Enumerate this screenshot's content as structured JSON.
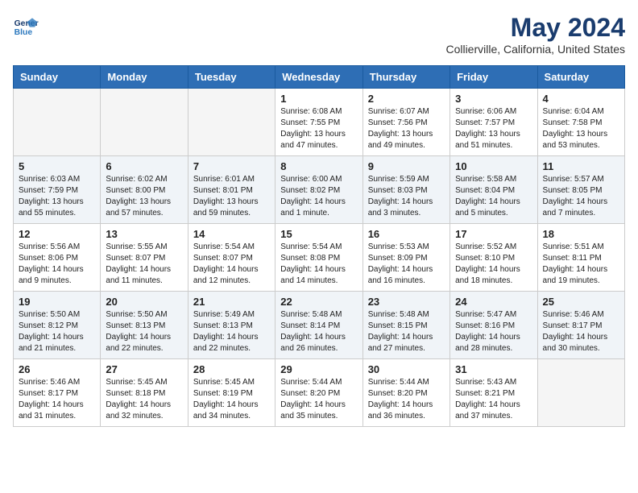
{
  "logo": {
    "line1": "General",
    "line2": "Blue"
  },
  "title": "May 2024",
  "subtitle": "Collierville, California, United States",
  "weekdays": [
    "Sunday",
    "Monday",
    "Tuesday",
    "Wednesday",
    "Thursday",
    "Friday",
    "Saturday"
  ],
  "weeks": [
    [
      {
        "day": "",
        "empty": true
      },
      {
        "day": "",
        "empty": true
      },
      {
        "day": "",
        "empty": true
      },
      {
        "day": "1",
        "sunrise": "6:08 AM",
        "sunset": "7:55 PM",
        "daylight": "13 hours and 47 minutes."
      },
      {
        "day": "2",
        "sunrise": "6:07 AM",
        "sunset": "7:56 PM",
        "daylight": "13 hours and 49 minutes."
      },
      {
        "day": "3",
        "sunrise": "6:06 AM",
        "sunset": "7:57 PM",
        "daylight": "13 hours and 51 minutes."
      },
      {
        "day": "4",
        "sunrise": "6:04 AM",
        "sunset": "7:58 PM",
        "daylight": "13 hours and 53 minutes."
      }
    ],
    [
      {
        "day": "5",
        "sunrise": "6:03 AM",
        "sunset": "7:59 PM",
        "daylight": "13 hours and 55 minutes."
      },
      {
        "day": "6",
        "sunrise": "6:02 AM",
        "sunset": "8:00 PM",
        "daylight": "13 hours and 57 minutes."
      },
      {
        "day": "7",
        "sunrise": "6:01 AM",
        "sunset": "8:01 PM",
        "daylight": "13 hours and 59 minutes."
      },
      {
        "day": "8",
        "sunrise": "6:00 AM",
        "sunset": "8:02 PM",
        "daylight": "14 hours and 1 minute."
      },
      {
        "day": "9",
        "sunrise": "5:59 AM",
        "sunset": "8:03 PM",
        "daylight": "14 hours and 3 minutes."
      },
      {
        "day": "10",
        "sunrise": "5:58 AM",
        "sunset": "8:04 PM",
        "daylight": "14 hours and 5 minutes."
      },
      {
        "day": "11",
        "sunrise": "5:57 AM",
        "sunset": "8:05 PM",
        "daylight": "14 hours and 7 minutes."
      }
    ],
    [
      {
        "day": "12",
        "sunrise": "5:56 AM",
        "sunset": "8:06 PM",
        "daylight": "14 hours and 9 minutes."
      },
      {
        "day": "13",
        "sunrise": "5:55 AM",
        "sunset": "8:07 PM",
        "daylight": "14 hours and 11 minutes."
      },
      {
        "day": "14",
        "sunrise": "5:54 AM",
        "sunset": "8:07 PM",
        "daylight": "14 hours and 12 minutes."
      },
      {
        "day": "15",
        "sunrise": "5:54 AM",
        "sunset": "8:08 PM",
        "daylight": "14 hours and 14 minutes."
      },
      {
        "day": "16",
        "sunrise": "5:53 AM",
        "sunset": "8:09 PM",
        "daylight": "14 hours and 16 minutes."
      },
      {
        "day": "17",
        "sunrise": "5:52 AM",
        "sunset": "8:10 PM",
        "daylight": "14 hours and 18 minutes."
      },
      {
        "day": "18",
        "sunrise": "5:51 AM",
        "sunset": "8:11 PM",
        "daylight": "14 hours and 19 minutes."
      }
    ],
    [
      {
        "day": "19",
        "sunrise": "5:50 AM",
        "sunset": "8:12 PM",
        "daylight": "14 hours and 21 minutes."
      },
      {
        "day": "20",
        "sunrise": "5:50 AM",
        "sunset": "8:13 PM",
        "daylight": "14 hours and 22 minutes."
      },
      {
        "day": "21",
        "sunrise": "5:49 AM",
        "sunset": "8:13 PM",
        "daylight": "14 hours and 22 minutes."
      },
      {
        "day": "22",
        "sunrise": "5:48 AM",
        "sunset": "8:14 PM",
        "daylight": "14 hours and 26 minutes."
      },
      {
        "day": "23",
        "sunrise": "5:48 AM",
        "sunset": "8:15 PM",
        "daylight": "14 hours and 27 minutes."
      },
      {
        "day": "24",
        "sunrise": "5:47 AM",
        "sunset": "8:16 PM",
        "daylight": "14 hours and 28 minutes."
      },
      {
        "day": "25",
        "sunrise": "5:46 AM",
        "sunset": "8:17 PM",
        "daylight": "14 hours and 30 minutes."
      }
    ],
    [
      {
        "day": "26",
        "sunrise": "5:46 AM",
        "sunset": "8:17 PM",
        "daylight": "14 hours and 31 minutes."
      },
      {
        "day": "27",
        "sunrise": "5:45 AM",
        "sunset": "8:18 PM",
        "daylight": "14 hours and 32 minutes."
      },
      {
        "day": "28",
        "sunrise": "5:45 AM",
        "sunset": "8:19 PM",
        "daylight": "14 hours and 34 minutes."
      },
      {
        "day": "29",
        "sunrise": "5:44 AM",
        "sunset": "8:20 PM",
        "daylight": "14 hours and 35 minutes."
      },
      {
        "day": "30",
        "sunrise": "5:44 AM",
        "sunset": "8:20 PM",
        "daylight": "14 hours and 36 minutes."
      },
      {
        "day": "31",
        "sunrise": "5:43 AM",
        "sunset": "8:21 PM",
        "daylight": "14 hours and 37 minutes."
      },
      {
        "day": "",
        "empty": true
      }
    ]
  ],
  "labels": {
    "sunrise": "Sunrise:",
    "sunset": "Sunset:",
    "daylight": "Daylight:"
  }
}
